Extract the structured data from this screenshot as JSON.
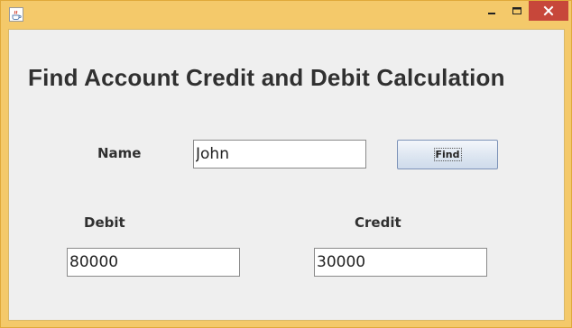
{
  "window": {
    "title": "",
    "close_color": "#c7473a",
    "frame_color": "#f4c96a"
  },
  "icons": {
    "app": "java-coffee-icon",
    "minimize": "minimize-icon",
    "maximize": "maximize-icon",
    "close": "close-icon"
  },
  "form": {
    "title": "Find Account Credit and Debit Calculation",
    "name_label": "Name",
    "name_value": "John",
    "find_label": "Find",
    "debit_label": "Debit",
    "debit_value": "80000",
    "credit_label": "Credit",
    "credit_value": "30000"
  }
}
